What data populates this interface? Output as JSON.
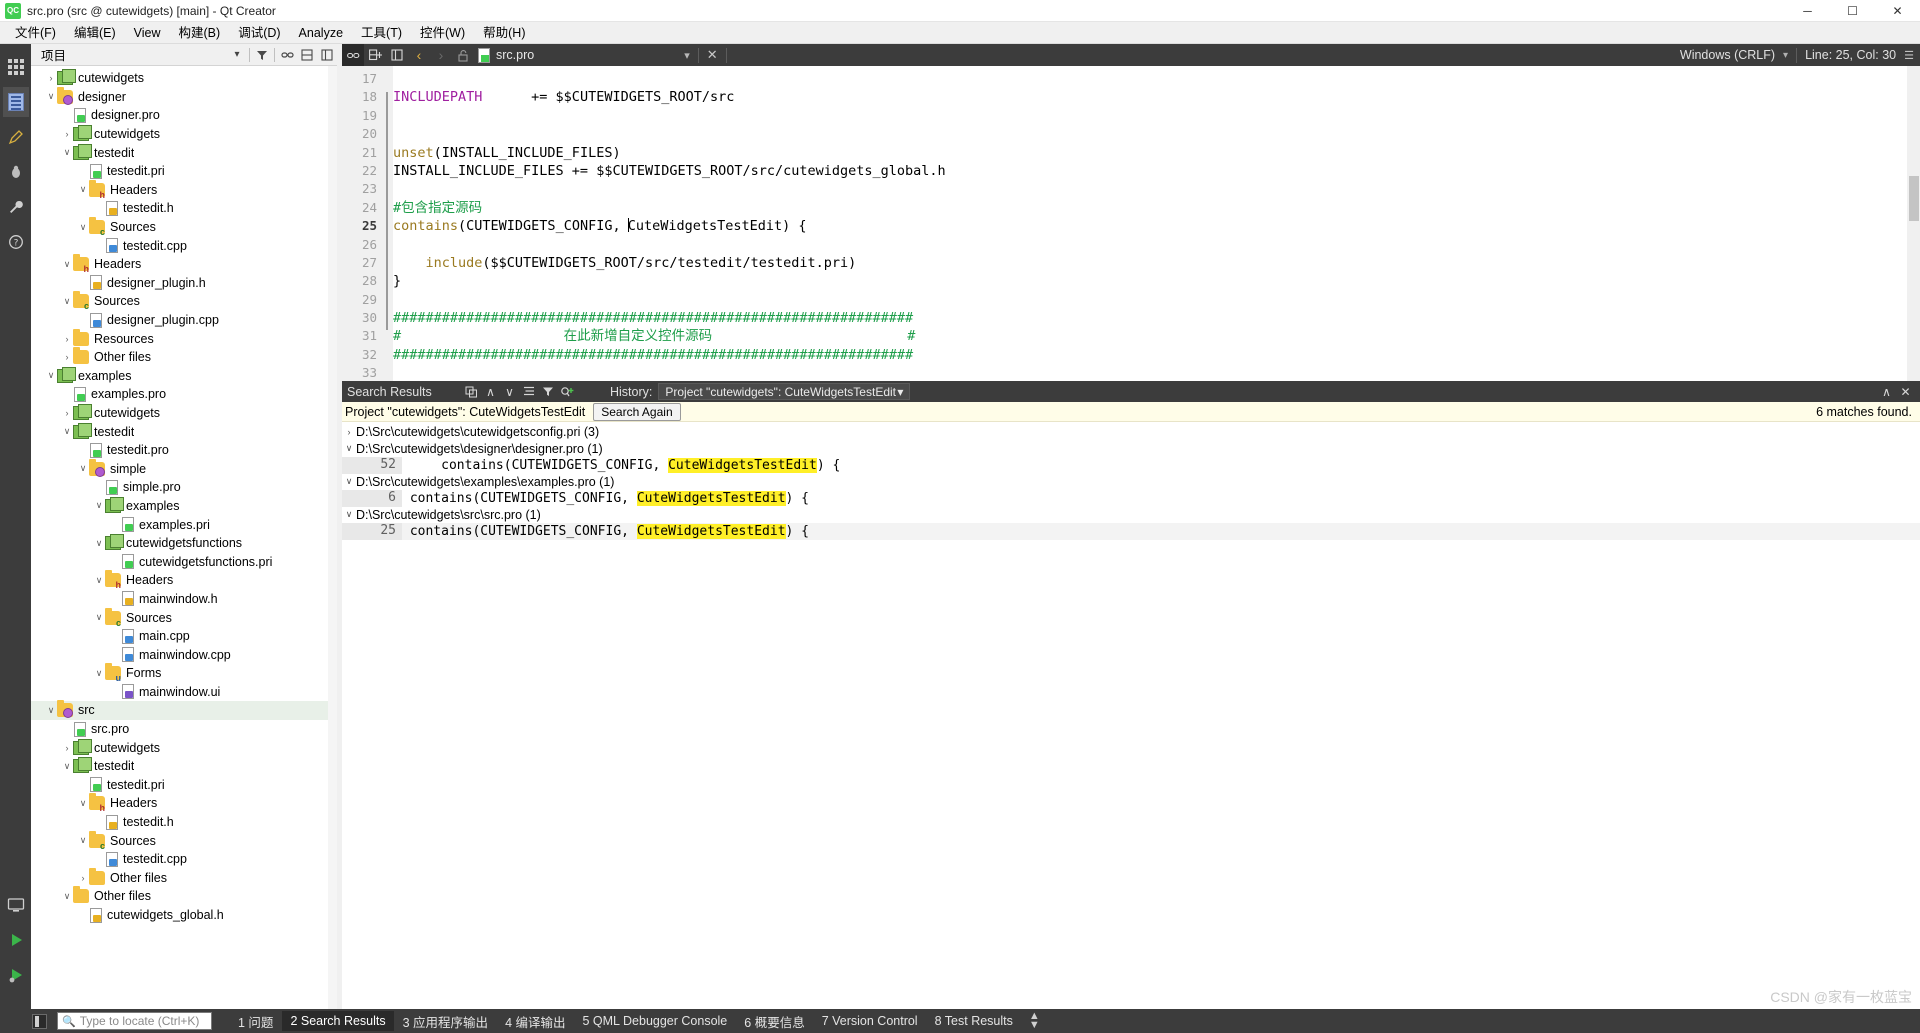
{
  "window": {
    "title": "src.pro (src @ cutewidgets) [main] - Qt Creator",
    "logo_text": "QC",
    "minimize": "─",
    "maximize": "☐",
    "close": "✕"
  },
  "menubar": {
    "items": [
      "文件(F)",
      "编辑(E)",
      "View",
      "构建(B)",
      "调试(D)",
      "Analyze",
      "工具(T)",
      "控件(W)",
      "帮助(H)"
    ]
  },
  "modebar": {
    "icons": [
      "grid-icon",
      "edit-document-icon",
      "design-pen-icon",
      "debug-bug-icon",
      "projects-wrench-icon",
      "help-question-icon",
      "desktop-target-icon",
      "run-play-icon",
      "debug-run-icon"
    ]
  },
  "project_panel": {
    "title": "项目",
    "filter_icon": "filter-icon",
    "dropdown_icon": "chevron-down-icon",
    "link_icon": "link-with-editor-icon",
    "split_icon": "split-icon",
    "close_icon": "close-icon",
    "tree": [
      {
        "depth": 1,
        "label": "cutewidgets",
        "arrow": "collapsed",
        "icon": "qt-project-icon"
      },
      {
        "depth": 1,
        "label": "designer",
        "arrow": "expanded",
        "icon": "folder-gear-icon"
      },
      {
        "depth": 2,
        "label": "designer.pro",
        "arrow": "none",
        "icon": "pro-file-icon"
      },
      {
        "depth": 2,
        "label": "cutewidgets",
        "arrow": "collapsed",
        "icon": "qt-project-icon"
      },
      {
        "depth": 2,
        "label": "testedit",
        "arrow": "expanded",
        "icon": "qt-project-icon"
      },
      {
        "depth": 3,
        "label": "testedit.pri",
        "arrow": "none",
        "icon": "pro-file-icon"
      },
      {
        "depth": 3,
        "label": "Headers",
        "arrow": "expanded",
        "icon": "folder-headers-icon"
      },
      {
        "depth": 4,
        "label": "testedit.h",
        "arrow": "none",
        "icon": "header-file-icon"
      },
      {
        "depth": 3,
        "label": "Sources",
        "arrow": "expanded",
        "icon": "folder-sources-icon"
      },
      {
        "depth": 4,
        "label": "testedit.cpp",
        "arrow": "none",
        "icon": "source-file-icon"
      },
      {
        "depth": 2,
        "label": "Headers",
        "arrow": "expanded",
        "icon": "folder-headers-icon"
      },
      {
        "depth": 3,
        "label": "designer_plugin.h",
        "arrow": "none",
        "icon": "header-file-icon"
      },
      {
        "depth": 2,
        "label": "Sources",
        "arrow": "expanded",
        "icon": "folder-sources-icon"
      },
      {
        "depth": 3,
        "label": "designer_plugin.cpp",
        "arrow": "none",
        "icon": "source-file-icon"
      },
      {
        "depth": 2,
        "label": "Resources",
        "arrow": "collapsed",
        "icon": "folder-resources-icon"
      },
      {
        "depth": 2,
        "label": "Other files",
        "arrow": "collapsed",
        "icon": "folder-other-icon"
      },
      {
        "depth": 1,
        "label": "examples",
        "arrow": "expanded",
        "icon": "qt-project-icon"
      },
      {
        "depth": 2,
        "label": "examples.pro",
        "arrow": "none",
        "icon": "pro-file-icon"
      },
      {
        "depth": 2,
        "label": "cutewidgets",
        "arrow": "collapsed",
        "icon": "qt-project-icon"
      },
      {
        "depth": 2,
        "label": "testedit",
        "arrow": "expanded",
        "icon": "qt-project-icon"
      },
      {
        "depth": 3,
        "label": "testedit.pro",
        "arrow": "none",
        "icon": "pro-file-icon"
      },
      {
        "depth": 3,
        "label": "simple",
        "arrow": "expanded",
        "icon": "folder-gear-icon"
      },
      {
        "depth": 4,
        "label": "simple.pro",
        "arrow": "none",
        "icon": "pro-file-icon"
      },
      {
        "depth": 4,
        "label": "examples",
        "arrow": "expanded",
        "icon": "qt-project-icon"
      },
      {
        "depth": 5,
        "label": "examples.pri",
        "arrow": "none",
        "icon": "pro-file-icon"
      },
      {
        "depth": 4,
        "label": "cutewidgetsfunctions",
        "arrow": "expanded",
        "icon": "qt-project-icon"
      },
      {
        "depth": 5,
        "label": "cutewidgetsfunctions.pri",
        "arrow": "none",
        "icon": "pro-file-icon"
      },
      {
        "depth": 4,
        "label": "Headers",
        "arrow": "expanded",
        "icon": "folder-headers-icon"
      },
      {
        "depth": 5,
        "label": "mainwindow.h",
        "arrow": "none",
        "icon": "header-file-icon"
      },
      {
        "depth": 4,
        "label": "Sources",
        "arrow": "expanded",
        "icon": "folder-sources-icon"
      },
      {
        "depth": 5,
        "label": "main.cpp",
        "arrow": "none",
        "icon": "source-file-icon"
      },
      {
        "depth": 5,
        "label": "mainwindow.cpp",
        "arrow": "none",
        "icon": "source-file-icon"
      },
      {
        "depth": 4,
        "label": "Forms",
        "arrow": "expanded",
        "icon": "folder-forms-icon"
      },
      {
        "depth": 5,
        "label": "mainwindow.ui",
        "arrow": "none",
        "icon": "ui-file-icon"
      },
      {
        "depth": 1,
        "label": "src",
        "arrow": "expanded",
        "icon": "folder-gear-icon",
        "selected": true
      },
      {
        "depth": 2,
        "label": "src.pro",
        "arrow": "none",
        "icon": "pro-file-icon"
      },
      {
        "depth": 2,
        "label": "cutewidgets",
        "arrow": "collapsed",
        "icon": "qt-project-icon"
      },
      {
        "depth": 2,
        "label": "testedit",
        "arrow": "expanded",
        "icon": "qt-project-icon"
      },
      {
        "depth": 3,
        "label": "testedit.pri",
        "arrow": "none",
        "icon": "pro-file-icon"
      },
      {
        "depth": 3,
        "label": "Headers",
        "arrow": "expanded",
        "icon": "folder-headers-icon"
      },
      {
        "depth": 4,
        "label": "testedit.h",
        "arrow": "none",
        "icon": "header-file-icon"
      },
      {
        "depth": 3,
        "label": "Sources",
        "arrow": "expanded",
        "icon": "folder-sources-icon"
      },
      {
        "depth": 4,
        "label": "testedit.cpp",
        "arrow": "none",
        "icon": "source-file-icon"
      },
      {
        "depth": 3,
        "label": "Other files",
        "arrow": "collapsed",
        "icon": "folder-other-icon"
      },
      {
        "depth": 2,
        "label": "Other files",
        "arrow": "expanded",
        "icon": "folder-other-icon"
      },
      {
        "depth": 3,
        "label": "cutewidgets_global.h",
        "arrow": "none",
        "icon": "header-file-icon"
      }
    ]
  },
  "editor_toolbar": {
    "link_btn": "link-icon",
    "split_btn": "split-horizontal-icon",
    "close_split_btn": "close-split-icon",
    "back_arrow": "‹",
    "forward_arrow": "›",
    "lock_icon": "unlocked-icon",
    "filename": "src.pro",
    "dropdown": "▾",
    "close": "✕",
    "line_ending": "Windows (CRLF)",
    "line_ending_dropdown": "▾",
    "cursor_position": "Line: 25, Col: 30",
    "expand_icon": "expand-icon"
  },
  "code": {
    "first_line": 17,
    "current_line": 25,
    "lines": [
      {
        "n": 17,
        "tokens": []
      },
      {
        "n": 18,
        "tokens": [
          {
            "t": "INCLUDEPATH",
            "c": "k-var"
          },
          {
            "t": "      += $$CUTEWIDGETS_ROOT/src",
            "c": "k-plain"
          }
        ]
      },
      {
        "n": 19,
        "tokens": []
      },
      {
        "n": 20,
        "tokens": []
      },
      {
        "n": 21,
        "tokens": [
          {
            "t": "unset",
            "c": "k-fn"
          },
          {
            "t": "(INSTALL_INCLUDE_FILES)",
            "c": "k-plain"
          }
        ]
      },
      {
        "n": 22,
        "tokens": [
          {
            "t": "INSTALL_INCLUDE_FILES += $$CUTEWIDGETS_ROOT/src/cutewidgets_global.h",
            "c": "k-plain"
          }
        ]
      },
      {
        "n": 23,
        "tokens": []
      },
      {
        "n": 24,
        "tokens": [
          {
            "t": "#包含指定源码",
            "c": "k-cmt"
          }
        ]
      },
      {
        "n": 25,
        "tokens": [
          {
            "t": "contains",
            "c": "k-fn"
          },
          {
            "t": "(CUTEWIDGETS_CONFIG, ",
            "c": "k-plain"
          },
          {
            "t": "CARET",
            "c": "caret"
          },
          {
            "t": "CuteWidgetsTestEdit) {",
            "c": "k-plain"
          }
        ]
      },
      {
        "n": 26,
        "tokens": []
      },
      {
        "n": 27,
        "tokens": [
          {
            "t": "    include",
            "c": "k-fn"
          },
          {
            "t": "($$CUTEWIDGETS_ROOT/src/testedit/testedit.pri)",
            "c": "k-plain"
          }
        ]
      },
      {
        "n": 28,
        "tokens": [
          {
            "t": "}",
            "c": "k-plain"
          }
        ]
      },
      {
        "n": 29,
        "tokens": []
      },
      {
        "n": 30,
        "tokens": [
          {
            "t": "################################################################",
            "c": "k-cmt"
          }
        ]
      },
      {
        "n": 31,
        "tokens": [
          {
            "t": "#                    在此新增自定义控件源码                        #",
            "c": "k-cmt"
          }
        ]
      },
      {
        "n": 32,
        "tokens": [
          {
            "t": "################################################################",
            "c": "k-cmt"
          }
        ]
      },
      {
        "n": 33,
        "tokens": []
      }
    ]
  },
  "search_results": {
    "title": "Search Results",
    "toolbar_icons": [
      "expand-collapse-icon",
      "previous-icon",
      "next-icon",
      "list-icon",
      "filter-icon",
      "new-search-icon"
    ],
    "prev_arrow": "∧",
    "next_arrow": "∨",
    "history_label": "History:",
    "history_value": "Project \"cutewidgets\": CuteWidgetsTestEdit",
    "history_dropdown": "▾",
    "minimize_icon": "∧",
    "close_icon": "✕",
    "info_text": "Project \"cutewidgets\": CuteWidgetsTestEdit",
    "search_again_label": "Search Again",
    "matches_text": "6 matches found.",
    "results": [
      {
        "type": "file",
        "arrow": "collapsed",
        "path": "D:\\Src\\cutewidgets\\cutewidgetsconfig.pri",
        "count": "(3)"
      },
      {
        "type": "file",
        "arrow": "expanded",
        "path": "D:\\Src\\cutewidgets\\designer\\designer.pro",
        "count": "(1)"
      },
      {
        "type": "hit",
        "lineno": "52",
        "pre": "    contains(CUTEWIDGETS_CONFIG, ",
        "match": "CuteWidgetsTestEdit",
        "post": ") {",
        "alt": false
      },
      {
        "type": "file",
        "arrow": "expanded",
        "path": "D:\\Src\\cutewidgets\\examples\\examples.pro",
        "count": "(1)"
      },
      {
        "type": "hit",
        "lineno": "6",
        "pre": "contains(CUTEWIDGETS_CONFIG, ",
        "match": "CuteWidgetsTestEdit",
        "post": ") {",
        "alt": false
      },
      {
        "type": "file",
        "arrow": "expanded",
        "path": "D:\\Src\\cutewidgets\\src\\src.pro",
        "count": "(1)"
      },
      {
        "type": "hit",
        "lineno": "25",
        "pre": "contains(CUTEWIDGETS_CONFIG, ",
        "match": "CuteWidgetsTestEdit",
        "post": ") {",
        "alt": true
      }
    ]
  },
  "statusbar": {
    "toggle_sidebar_icon": "toggle-sidebar-icon",
    "locator_placeholder": "Type to locate (Ctrl+K)",
    "locator_icon": "search-icon",
    "panes": [
      {
        "num": "1",
        "label": "问题",
        "active": false
      },
      {
        "num": "2",
        "label": "Search Results",
        "active": true
      },
      {
        "num": "3",
        "label": "应用程序输出",
        "active": false
      },
      {
        "num": "4",
        "label": "编译输出",
        "active": false
      },
      {
        "num": "5",
        "label": "QML Debugger Console",
        "active": false
      },
      {
        "num": "6",
        "label": "概要信息",
        "active": false
      },
      {
        "num": "7",
        "label": "Version Control",
        "active": false
      },
      {
        "num": "8",
        "label": "Test Results",
        "active": false
      }
    ],
    "updown_icon": "up-down-arrows-icon"
  },
  "watermark": "CSDN @家有一枚蓝宝"
}
